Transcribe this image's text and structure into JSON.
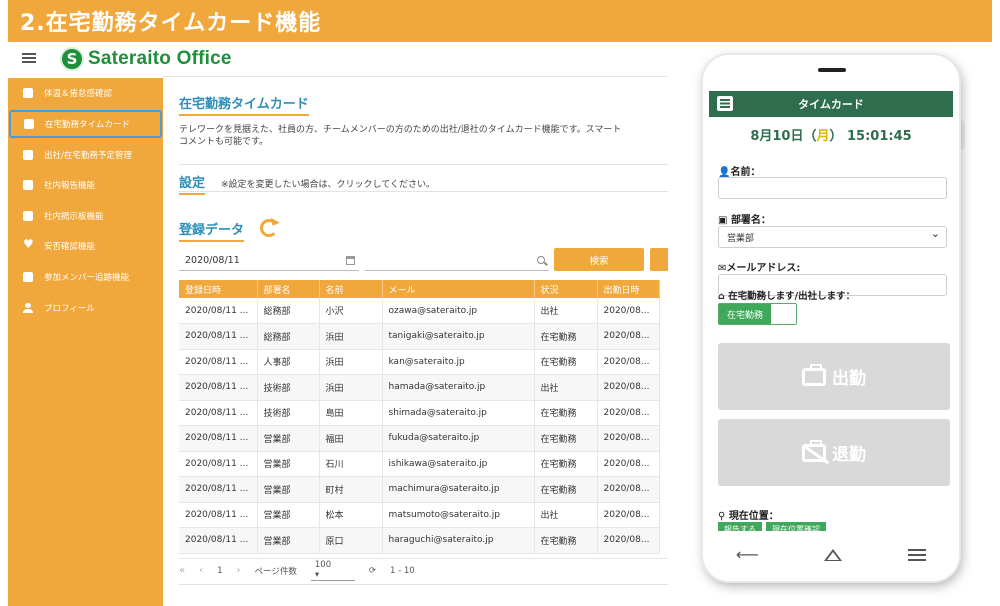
{
  "banner": {
    "title": "2.在宅勤務タイムカード機能"
  },
  "app": {
    "logo_letter": "S",
    "logo_text": "Sateraito Office"
  },
  "sidebar": {
    "items": [
      {
        "label": "体温＆倦怠感確認",
        "icon": "dashboard-icon"
      },
      {
        "label": "在宅勤務タイムカード",
        "icon": "card-icon",
        "active": true
      },
      {
        "label": "出社/在宅勤務予定管理",
        "icon": "calendar-icon"
      },
      {
        "label": "社内報告機能",
        "icon": "document-icon"
      },
      {
        "label": "社内掲示板機能",
        "icon": "document-icon"
      },
      {
        "label": "安否確認機能",
        "icon": "heart-icon"
      },
      {
        "label": "参加メンバー追跡機能",
        "icon": "tracking-icon"
      },
      {
        "label": "プロフィール",
        "icon": "person-icon"
      }
    ],
    "color": "#f0a73b"
  },
  "main": {
    "title": "在宅勤務タイムカード",
    "description_line1": "テレワークを見据えた、社員の方、チームメンバーの方のための出社/退社のタイムカード機能です。スマート",
    "description_line2": "コメントも可能です。",
    "settings_title": "設定",
    "settings_note": "※設定を変更したい場合は、クリックしてください。",
    "data_title": "登録データ",
    "date_value": "2020/08/11",
    "search_button": "検索",
    "table": {
      "headers": [
        "登録日時",
        "部署名",
        "名前",
        "メール",
        "状況",
        "出勤日時"
      ],
      "rows": [
        [
          "2020/08/11 ...",
          "総務部",
          "小沢",
          "ozawa@sateraito.jp",
          "出社",
          "2020/08..."
        ],
        [
          "2020/08/11 ...",
          "総務部",
          "浜田",
          "tanigaki@sateraito.jp",
          "在宅勤務",
          "2020/08..."
        ],
        [
          "2020/08/11 ...",
          "人事部",
          "浜田",
          "kan@sateraito.jp",
          "在宅勤務",
          "2020/08..."
        ],
        [
          "2020/08/11 ...",
          "技術部",
          "浜田",
          "hamada@sateraito.jp",
          "出社",
          "2020/08..."
        ],
        [
          "2020/08/11 ...",
          "技術部",
          "島田",
          "shimada@sateraito.jp",
          "在宅勤務",
          "2020/08..."
        ],
        [
          "2020/08/11 ...",
          "営業部",
          "福田",
          "fukuda@sateraito.jp",
          "在宅勤務",
          "2020/08..."
        ],
        [
          "2020/08/11 ...",
          "営業部",
          "石川",
          "ishikawa@sateraito.jp",
          "在宅勤務",
          "2020/08..."
        ],
        [
          "2020/08/11 ...",
          "営業部",
          "町村",
          "machimura@sateraito.jp",
          "在宅勤務",
          "2020/08..."
        ],
        [
          "2020/08/11 ...",
          "営業部",
          "松本",
          "matsumoto@sateraito.jp",
          "出社",
          "2020/08..."
        ],
        [
          "2020/08/11 ...",
          "営業部",
          "原口",
          "haraguchi@sateraito.jp",
          "在宅勤務",
          "2020/08..."
        ]
      ]
    },
    "pager": {
      "first": "«",
      "prev": "‹",
      "page": "1",
      "next": "›",
      "last": "»",
      "page_size_label": "ページ件数",
      "page_size": "100",
      "range": "1 - 10"
    }
  },
  "phone": {
    "title": "タイムカード",
    "date": "8月10日（",
    "weekday": "月",
    "date_close": "）",
    "time": "15:01:45",
    "name_label": "名前：",
    "name_value": "",
    "dept_label": "部署名：",
    "dept_value": "営業部",
    "mail_label": "メールアドレス:",
    "mail_value": "",
    "mode_label": "在宅勤務します/出社します：",
    "mode_value": "在宅勤務",
    "clock_in": "出勤",
    "clock_out": "退勤",
    "location_label": "現在位置：",
    "location_btn1": "報告する",
    "location_btn2": "現在位置確認",
    "accent": "#2e6d4d"
  }
}
